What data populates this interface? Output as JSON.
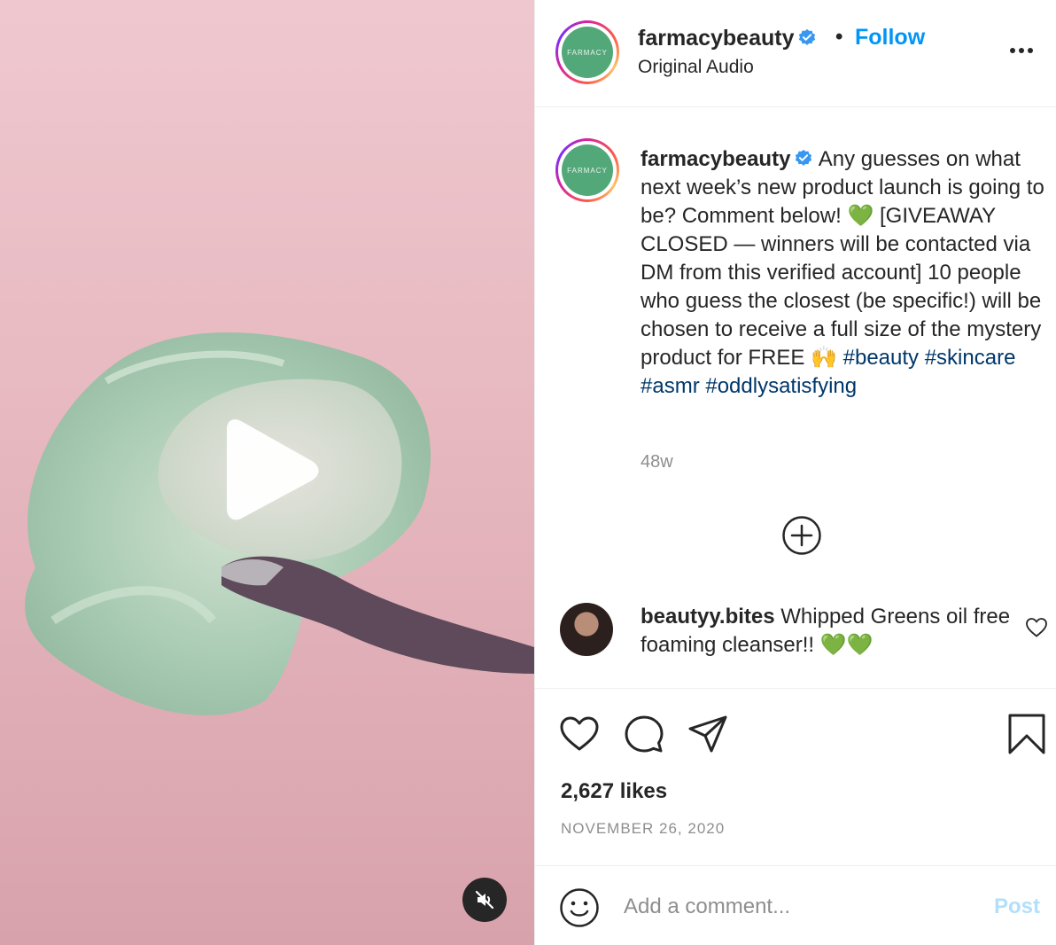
{
  "header": {
    "username": "farmacybeauty",
    "avatar_text": "FARMACY",
    "separator": "•",
    "follow_label": "Follow",
    "audio": "Original Audio"
  },
  "caption": {
    "username": "farmacybeauty",
    "text_1": "Any guesses on what next week’s new product launch is going to be? Comment below! 💚 [GIVEAWAY CLOSED — winners will be contacted via DM from this verified account] 10 people who guess the closest (be specific!) will be chosen to receive a full size of the mystery product for FREE 🙌",
    "hashtags": [
      "#beauty",
      "#skincare",
      "#asmr",
      "#oddlysatisfying"
    ],
    "age": "48w"
  },
  "comment": {
    "username": "beautyy.bites",
    "text": "Whipped Greens oil free foaming cleanser!! 💚💚"
  },
  "stats": {
    "likes": "2,627 likes",
    "date": "NOVEMBER 26, 2020"
  },
  "composer": {
    "placeholder": "Add a comment...",
    "post_label": "Post"
  },
  "colors": {
    "accent": "#0095f6",
    "hashtag": "#00376b",
    "muted": "#8e8e8e",
    "post_disabled": "#b2dffc",
    "brand_green": "#53a87a"
  },
  "icons": [
    "verified-badge-icon",
    "more-options-icon",
    "add-circle-icon",
    "heart-icon",
    "comment-icon",
    "share-icon",
    "bookmark-icon",
    "emoji-icon",
    "play-icon",
    "muted-speaker-icon"
  ]
}
